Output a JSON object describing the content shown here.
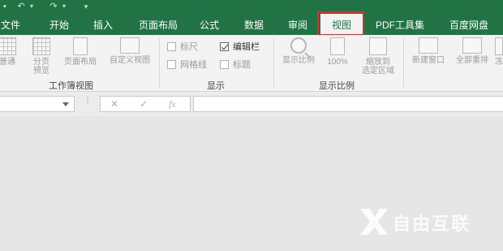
{
  "tabs": {
    "file": "文件",
    "home": "开始",
    "insert": "插入",
    "page_layout": "页面布局",
    "formulas": "公式",
    "data": "数据",
    "review": "审阅",
    "view": "视图",
    "pdf_tools": "PDF工具集",
    "baidu_disk": "百度网盘"
  },
  "workbook_views": {
    "normal": "普通",
    "page_break_preview": "分页\n预览",
    "page_layout": "页面布局",
    "custom_views": "自定义视图",
    "group_label": "工作簿视图"
  },
  "show": {
    "ruler": "标尺",
    "formula_bar": "编辑栏",
    "gridlines": "网格线",
    "headings": "标题",
    "group_label": "显示",
    "formula_bar_checked": true,
    "ruler_checked": false,
    "gridlines_checked": false,
    "headings_checked": false
  },
  "zoom": {
    "zoom": "显示比例",
    "hundred": "100%",
    "zoom_to_selection": "缩放到\n选定区域",
    "group_label": "显示比例"
  },
  "window": {
    "new_window": "新建窗口",
    "arrange_all": "全部重排",
    "truncated": "冻"
  },
  "formula_bar": {
    "fx": "fx",
    "cancel": "✕",
    "enter": "✓"
  },
  "watermark": {
    "text": "自由互联"
  },
  "colors": {
    "accent": "#217346",
    "highlight": "#d9302b"
  }
}
